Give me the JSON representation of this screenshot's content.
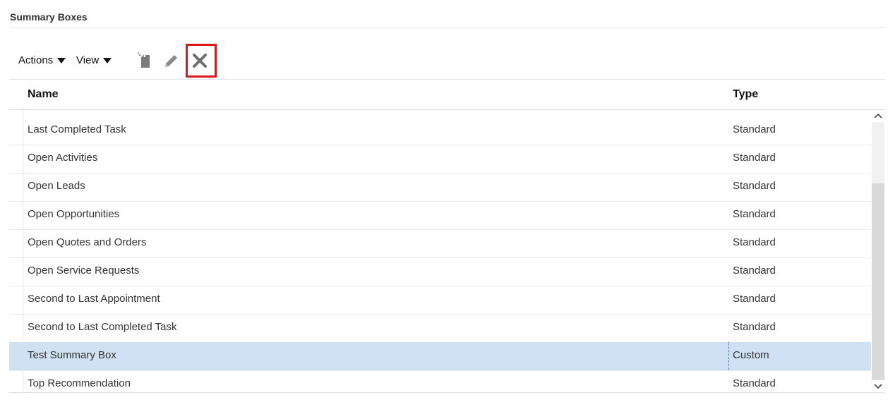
{
  "section": {
    "title": "Summary Boxes"
  },
  "toolbar": {
    "actions_label": "Actions",
    "view_label": "View",
    "dropdown_icon": "caret-down-icon",
    "add_icon": "new-document-icon",
    "edit_icon": "pencil-icon",
    "delete_icon": "close-x-icon",
    "highlight_color": "#e0161e"
  },
  "table": {
    "columns": [
      "Name",
      "Type"
    ],
    "rows": [
      {
        "name": "Last Completed Task",
        "type": "Standard",
        "selected": false
      },
      {
        "name": "Open Activities",
        "type": "Standard",
        "selected": false
      },
      {
        "name": "Open Leads",
        "type": "Standard",
        "selected": false
      },
      {
        "name": "Open Opportunities",
        "type": "Standard",
        "selected": false
      },
      {
        "name": "Open Quotes and Orders",
        "type": "Standard",
        "selected": false
      },
      {
        "name": "Open Service Requests",
        "type": "Standard",
        "selected": false
      },
      {
        "name": "Second to Last Appointment",
        "type": "Standard",
        "selected": false
      },
      {
        "name": "Second to Last Completed Task",
        "type": "Standard",
        "selected": false
      },
      {
        "name": "Test Summary Box",
        "type": "Custom",
        "selected": true
      },
      {
        "name": "Top Recommendation",
        "type": "Standard",
        "selected": false
      }
    ],
    "selected_color": "#d0e1f3"
  }
}
